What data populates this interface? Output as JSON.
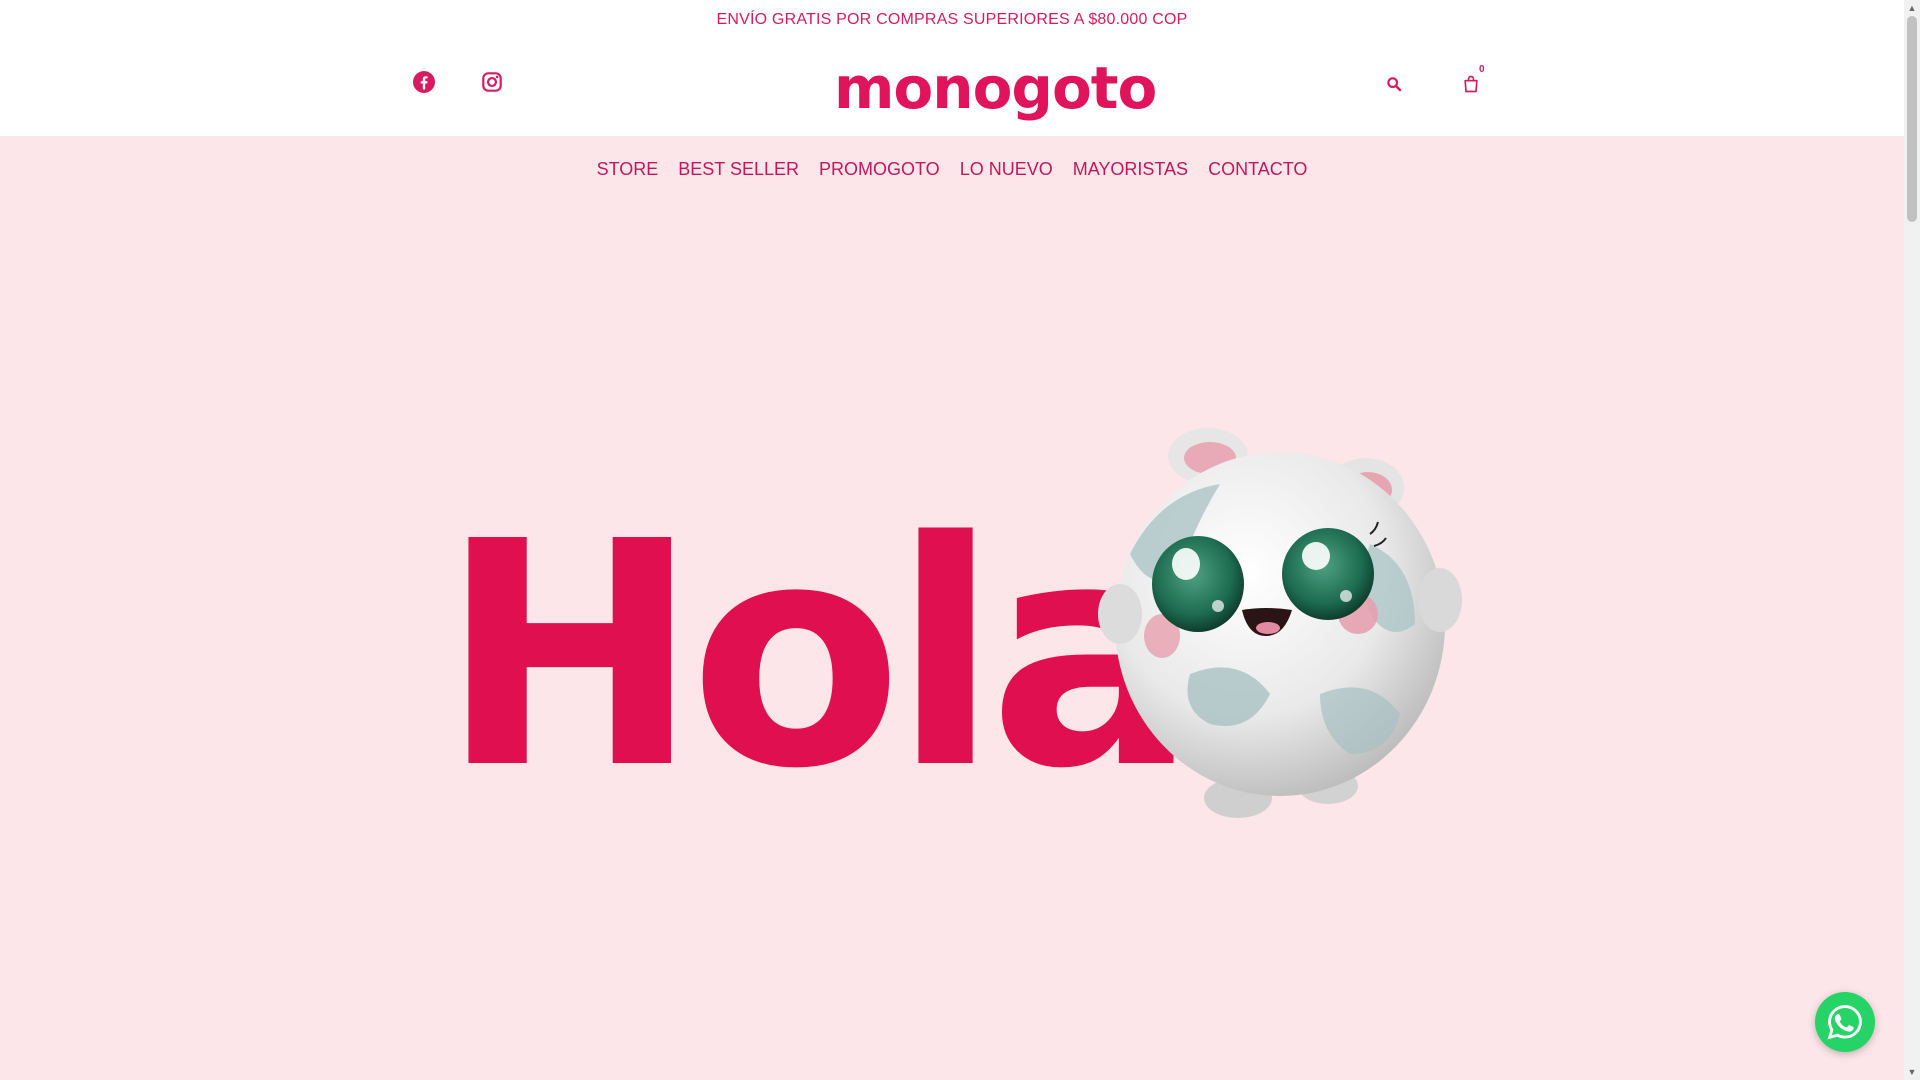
{
  "announcement": {
    "text": "ENVÍO GRATIS POR COMPRAS SUPERIORES A $80.000 COP"
  },
  "header": {
    "logo_text": "monogoto",
    "social": {
      "facebook_icon": "facebook-icon",
      "instagram_icon": "instagram-icon"
    },
    "search_icon": "search-icon",
    "cart_icon": "cart-icon",
    "cart_count": "0"
  },
  "nav": {
    "items": [
      {
        "label": "STORE"
      },
      {
        "label": "BEST SELLER"
      },
      {
        "label": "PROMOGOTO"
      },
      {
        "label": "LO NUEVO"
      },
      {
        "label": "MAYORISTAS"
      },
      {
        "label": "CONTACTO"
      }
    ]
  },
  "hero": {
    "headline": "Hola",
    "mascot": "mascot-image"
  },
  "whatsapp": {
    "icon": "whatsapp-icon"
  },
  "colors": {
    "brand": "#df0f50",
    "nav_text": "#c2185b",
    "hero_bg": "#fde6ea",
    "whatsapp": "#25d366"
  }
}
